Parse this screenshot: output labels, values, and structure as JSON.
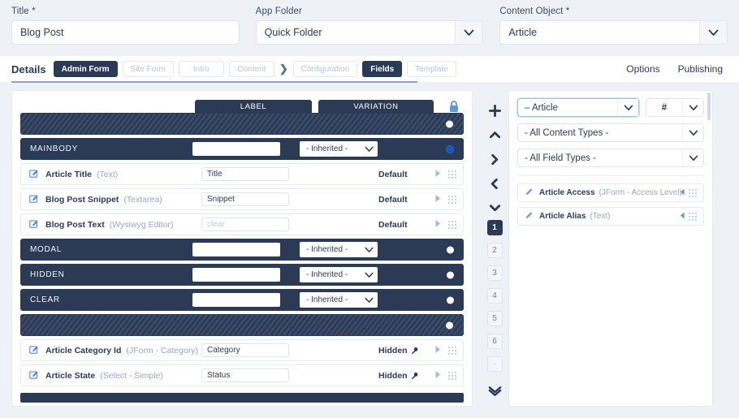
{
  "form": {
    "title_field": {
      "label": "Title *",
      "value": "Blog Post"
    },
    "app_folder_field": {
      "label": "App Folder",
      "value": "Quick Folder"
    },
    "content_object_field": {
      "label": "Content Object *",
      "value": "Article"
    }
  },
  "tabbar": {
    "details_label": "Details",
    "separator": "❯",
    "tabs": [
      {
        "label": "Admin Form",
        "state": "active"
      },
      {
        "label": "Site Form",
        "state": "ghost"
      },
      {
        "label": "Intro",
        "state": "ghost"
      },
      {
        "label": "Content",
        "state": "ghost"
      }
    ],
    "tabs2": [
      {
        "label": "Configuration",
        "state": "ghost"
      },
      {
        "label": "Fields",
        "state": "active"
      },
      {
        "label": "Template",
        "state": "ghost"
      }
    ],
    "right_links": [
      "Options",
      "Publishing"
    ]
  },
  "editor": {
    "columns": {
      "label": "LABEL",
      "variation": "VARIATION"
    },
    "lock_icon": "lock-icon",
    "rows": [
      {
        "kind": "striped",
        "name": "",
        "marker": "dot"
      },
      {
        "kind": "section",
        "name": "MAINBODY",
        "input": "",
        "variation": "- Inherited -",
        "marker": "ring"
      },
      {
        "kind": "field",
        "name": "Article Title",
        "type": "(Text)",
        "input": "Title",
        "input_placeholder": false,
        "status": "Default",
        "wrench": false
      },
      {
        "kind": "field",
        "name": "Blog Post Snippet",
        "type": "(Textarea)",
        "input": "Snippet",
        "input_placeholder": false,
        "status": "Default",
        "wrench": false
      },
      {
        "kind": "field",
        "name": "Blog Post Text",
        "type": "(Wysiwyg Editor)",
        "input": "clear",
        "input_placeholder": true,
        "status": "Default",
        "wrench": false
      },
      {
        "kind": "section",
        "name": "MODAL",
        "input": "",
        "variation": "- Inherited -",
        "marker": "dot"
      },
      {
        "kind": "section",
        "name": "HIDDEN",
        "input": "",
        "variation": "- Inherited -",
        "marker": "dot"
      },
      {
        "kind": "section",
        "name": "CLEAR",
        "input": "",
        "variation": "- Inherited -",
        "marker": "dot"
      },
      {
        "kind": "striped",
        "name": "",
        "marker": "dot"
      },
      {
        "kind": "field",
        "name": "Article Category Id",
        "type": "(JForm - Category)",
        "input": "Category",
        "input_placeholder": false,
        "status": "Hidden",
        "wrench": true
      },
      {
        "kind": "field",
        "name": "Article State",
        "type": "(Select - Simple)",
        "input": "Status",
        "input_placeholder": false,
        "status": "Hidden",
        "wrench": true
      }
    ]
  },
  "sidebar": {
    "tools": [
      {
        "icon": "plus-icon",
        "name": "add-field-button"
      },
      {
        "icon": "chevron-up-icon",
        "name": "move-up-button"
      },
      {
        "icon": "chevron-right-icon",
        "name": "move-right-button"
      },
      {
        "icon": "chevron-left-icon",
        "name": "move-left-button"
      },
      {
        "icon": "chevron-down-icon",
        "name": "move-down-button"
      }
    ],
    "pages": [
      "1",
      "2",
      "3",
      "4",
      "5",
      "6"
    ],
    "pages_active": "1",
    "page_dot": "·",
    "bottom_icon": "double-chevron-down-icon",
    "filters": {
      "object_select": "– Article",
      "hash_select": "#",
      "content_types_select": "- All Content Types -",
      "field_types_select": "- All Field Types -"
    },
    "items": [
      {
        "name": "Article Access",
        "type": "(JForm - Access Level)"
      },
      {
        "name": "Article Alias",
        "type": "(Text)"
      }
    ]
  },
  "colors": {
    "dark_navy": "#2b3a55",
    "accent_blue": "#1763e8",
    "page_bg": "#eef1f6",
    "muted_text": "#97a7c4"
  }
}
